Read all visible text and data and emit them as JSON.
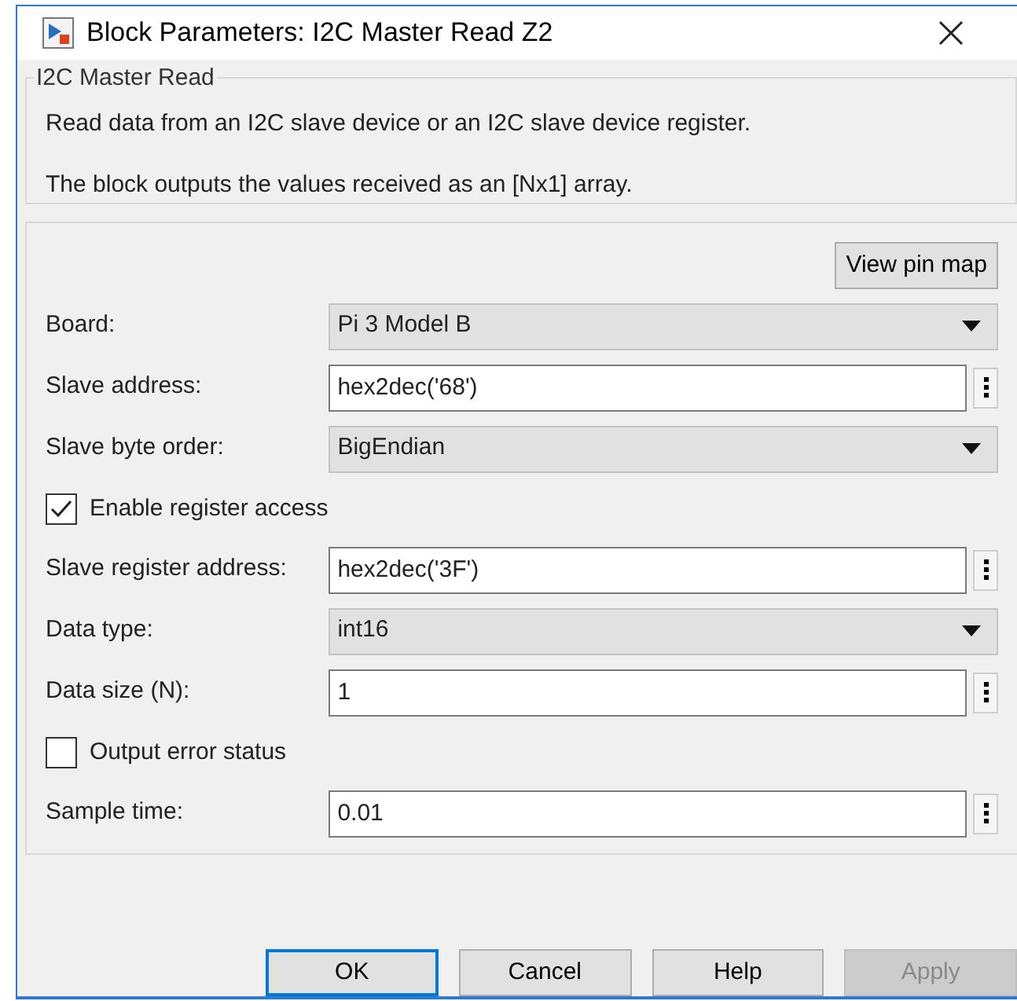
{
  "window": {
    "title": "Block Parameters: I2C Master Read Z2"
  },
  "description": {
    "group_title": "I2C Master Read",
    "lines": [
      "Read data from an I2C slave device or an I2C slave device register.",
      "The block outputs the values received as an [Nx1] array."
    ]
  },
  "view_pin_map_button": "View pin map",
  "parameters": [
    {
      "kind": "dropdown",
      "label": "Board:",
      "value": "Pi 3 Model B"
    },
    {
      "kind": "text",
      "label": "Slave address:",
      "value": "hex2dec('68')"
    },
    {
      "kind": "dropdown",
      "label": "Slave byte order:",
      "value": "BigEndian"
    },
    {
      "kind": "checkbox",
      "label": "Enable register access",
      "checked": true
    },
    {
      "kind": "text",
      "label": "Slave register address:",
      "value": "hex2dec('3F')"
    },
    {
      "kind": "dropdown",
      "label": "Data type:",
      "value": "int16"
    },
    {
      "kind": "text",
      "label": "Data size (N):",
      "value": "1"
    },
    {
      "kind": "checkbox",
      "label": "Output error status",
      "checked": false
    },
    {
      "kind": "text",
      "label": "Sample time:",
      "value": "0.01"
    }
  ],
  "buttons": [
    {
      "label": "OK",
      "focused": true,
      "disabled": false
    },
    {
      "label": "Cancel",
      "focused": false,
      "disabled": false
    },
    {
      "label": "Help",
      "focused": false,
      "disabled": false
    },
    {
      "label": "Apply",
      "focused": false,
      "disabled": true
    }
  ]
}
